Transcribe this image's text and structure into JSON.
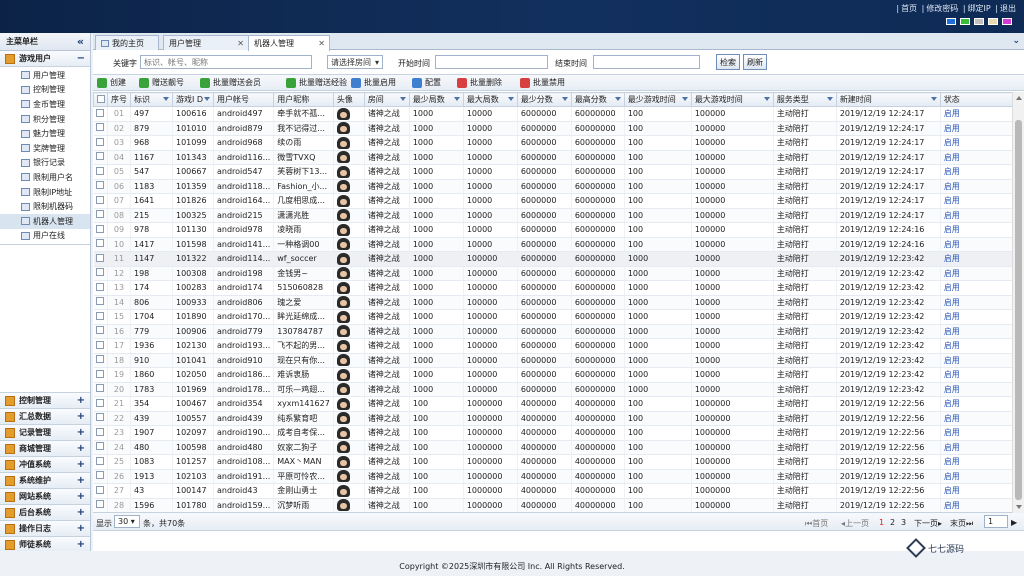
{
  "top_links": [
    "首页",
    "修改密码",
    "绑定IP",
    "退出"
  ],
  "theme_colors": [
    "#1e6fd9",
    "#3dbb3d",
    "#c0c0c0",
    "#e7d8b0",
    "#d53bd6"
  ],
  "sidebar": {
    "title": "主菜单栏",
    "collapse_icon": "double-chevron-left-icon",
    "open_group": {
      "label": "游戏用户",
      "toggle": "−"
    },
    "items": [
      "用户管理",
      "控制管理",
      "金币管理",
      "积分管理",
      "魅力管理",
      "奖牌管理",
      "银行记录",
      "限制用户名",
      "限制IP地址",
      "限制机器码",
      "机器人管理",
      "用户在线"
    ],
    "active_item": "机器人管理",
    "groups": [
      "控制管理",
      "汇总数据",
      "记录管理",
      "商城管理",
      "冲值系统",
      "系统维护",
      "网站系统",
      "后台系统",
      "操作日志",
      "师徒系统"
    ]
  },
  "tabs": [
    {
      "label": "我的主页",
      "closable": false
    },
    {
      "label": "用户管理",
      "closable": true
    },
    {
      "label": "机器人管理",
      "closable": true
    }
  ],
  "active_tab": "机器人管理",
  "search": {
    "keyword_label": "关键字",
    "keyword_placeholder": "标识、帐号、昵称",
    "room_select": "请选择房间",
    "start_label": "开始时间",
    "end_label": "结束时间",
    "search_button": "检索",
    "refresh_button": "刷新"
  },
  "toolbar": [
    {
      "label": "创建",
      "color": "#3aa23a"
    },
    {
      "label": "赠送靓号",
      "color": "#3aa23a"
    },
    {
      "label": "批量赠送会员",
      "color": "#3aa23a"
    },
    {
      "label": "批量赠送经验",
      "color": "#3aa23a"
    },
    {
      "label": "批量启用",
      "color": "#3f7fd0"
    },
    {
      "label": "配置",
      "color": "#3f7fd0"
    },
    {
      "label": "批量删除",
      "color": "#d84040"
    },
    {
      "label": "批量禁用",
      "color": "#d84040"
    }
  ],
  "table": {
    "columns": [
      "序号",
      "标识",
      "游戏I D",
      "用户帐号",
      "用户昵称",
      "头像",
      "房间",
      "最少局数",
      "最大局数",
      "最少分数",
      "最高分数",
      "最少游戏时间",
      "最大游戏时间",
      "服务类型",
      "新建时间",
      "状态"
    ],
    "rows": [
      [
        "01",
        "497",
        "100616",
        "android497",
        "牵手就不孤...",
        "诸神之战",
        "1000",
        "10000",
        "6000000",
        "60000000",
        "100",
        "100000",
        "主动陪打",
        "2019/12/19 12:24:17",
        "启用"
      ],
      [
        "02",
        "879",
        "101010",
        "android879",
        "我不记得过...",
        "诸神之战",
        "1000",
        "10000",
        "6000000",
        "60000000",
        "100",
        "100000",
        "主动陪打",
        "2019/12/19 12:24:17",
        "启用"
      ],
      [
        "03",
        "968",
        "101099",
        "android968",
        "续の雨",
        "诸神之战",
        "1000",
        "10000",
        "6000000",
        "60000000",
        "100",
        "100000",
        "主动陪打",
        "2019/12/19 12:24:17",
        "启用"
      ],
      [
        "04",
        "1167",
        "101343",
        "android116...",
        "微雪TVXQ",
        "诸神之战",
        "1000",
        "10000",
        "6000000",
        "60000000",
        "100",
        "100000",
        "主动陪打",
        "2019/12/19 12:24:17",
        "启用"
      ],
      [
        "05",
        "547",
        "100667",
        "android547",
        "芙蓉树下13...",
        "诸神之战",
        "1000",
        "10000",
        "6000000",
        "60000000",
        "100",
        "100000",
        "主动陪打",
        "2019/12/19 12:24:17",
        "启用"
      ],
      [
        "06",
        "1183",
        "101359",
        "android118...",
        "Fashion_小...",
        "诸神之战",
        "1000",
        "10000",
        "6000000",
        "60000000",
        "100",
        "100000",
        "主动陪打",
        "2019/12/19 12:24:17",
        "启用"
      ],
      [
        "07",
        "1641",
        "101826",
        "android164...",
        "几度相思成...",
        "诸神之战",
        "1000",
        "10000",
        "6000000",
        "60000000",
        "100",
        "100000",
        "主动陪打",
        "2019/12/19 12:24:17",
        "启用"
      ],
      [
        "08",
        "215",
        "100325",
        "android215",
        "潇潇兆胜",
        "诸神之战",
        "1000",
        "10000",
        "6000000",
        "60000000",
        "100",
        "100000",
        "主动陪打",
        "2019/12/19 12:24:17",
        "启用"
      ],
      [
        "09",
        "978",
        "101130",
        "android978",
        "凌晓雨",
        "诸神之战",
        "1000",
        "10000",
        "6000000",
        "60000000",
        "100",
        "100000",
        "主动陪打",
        "2019/12/19 12:24:16",
        "启用"
      ],
      [
        "10",
        "1417",
        "101598",
        "android141...",
        "一种格调00",
        "诸神之战",
        "1000",
        "10000",
        "6000000",
        "60000000",
        "100",
        "100000",
        "主动陪打",
        "2019/12/19 12:24:16",
        "启用"
      ],
      [
        "11",
        "1147",
        "101322",
        "android114...",
        "wf_soccer",
        "诸神之战",
        "1000",
        "100000",
        "6000000",
        "60000000",
        "1000",
        "10000",
        "主动陪打",
        "2019/12/19 12:23:42",
        "启用"
      ],
      [
        "12",
        "198",
        "100308",
        "android198",
        "金钱男~",
        "诸神之战",
        "1000",
        "100000",
        "6000000",
        "60000000",
        "1000",
        "10000",
        "主动陪打",
        "2019/12/19 12:23:42",
        "启用"
      ],
      [
        "13",
        "174",
        "100283",
        "android174",
        "515060828",
        "诸神之战",
        "1000",
        "100000",
        "6000000",
        "60000000",
        "1000",
        "10000",
        "主动陪打",
        "2019/12/19 12:23:42",
        "启用"
      ],
      [
        "14",
        "806",
        "100933",
        "android806",
        "瑰之爱",
        "诸神之战",
        "1000",
        "100000",
        "6000000",
        "60000000",
        "1000",
        "10000",
        "主动陪打",
        "2019/12/19 12:23:42",
        "启用"
      ],
      [
        "15",
        "1704",
        "101890",
        "android170...",
        "眸光延绵成...",
        "诸神之战",
        "1000",
        "100000",
        "6000000",
        "60000000",
        "1000",
        "10000",
        "主动陪打",
        "2019/12/19 12:23:42",
        "启用"
      ],
      [
        "16",
        "779",
        "100906",
        "android779",
        "130784787",
        "诸神之战",
        "1000",
        "100000",
        "6000000",
        "60000000",
        "1000",
        "10000",
        "主动陪打",
        "2019/12/19 12:23:42",
        "启用"
      ],
      [
        "17",
        "1936",
        "102130",
        "android193...",
        "飞不起的男...",
        "诸神之战",
        "1000",
        "100000",
        "6000000",
        "60000000",
        "1000",
        "10000",
        "主动陪打",
        "2019/12/19 12:23:42",
        "启用"
      ],
      [
        "18",
        "910",
        "101041",
        "android910",
        "现在只有你...",
        "诸神之战",
        "1000",
        "100000",
        "6000000",
        "60000000",
        "1000",
        "10000",
        "主动陪打",
        "2019/12/19 12:23:42",
        "启用"
      ],
      [
        "19",
        "1860",
        "102050",
        "android186...",
        "难诉衷肠",
        "诸神之战",
        "1000",
        "100000",
        "6000000",
        "60000000",
        "1000",
        "10000",
        "主动陪打",
        "2019/12/19 12:23:42",
        "启用"
      ],
      [
        "20",
        "1783",
        "101969",
        "android178...",
        "可乐—鸡翅...",
        "诸神之战",
        "1000",
        "100000",
        "6000000",
        "60000000",
        "1000",
        "10000",
        "主动陪打",
        "2019/12/19 12:23:42",
        "启用"
      ],
      [
        "21",
        "354",
        "100467",
        "android354",
        "xyxm141627",
        "诸神之战",
        "100",
        "1000000",
        "4000000",
        "40000000",
        "100",
        "1000000",
        "主动陪打",
        "2019/12/19 12:22:56",
        "启用"
      ],
      [
        "22",
        "439",
        "100557",
        "android439",
        "纯系繁育吧",
        "诸神之战",
        "100",
        "1000000",
        "4000000",
        "40000000",
        "100",
        "1000000",
        "主动陪打",
        "2019/12/19 12:22:56",
        "启用"
      ],
      [
        "23",
        "1907",
        "102097",
        "android190...",
        "成考自考保...",
        "诸神之战",
        "100",
        "1000000",
        "4000000",
        "40000000",
        "100",
        "1000000",
        "主动陪打",
        "2019/12/19 12:22:56",
        "启用"
      ],
      [
        "24",
        "480",
        "100598",
        "android480",
        "奴家二狗子",
        "诸神之战",
        "100",
        "1000000",
        "4000000",
        "40000000",
        "100",
        "1000000",
        "主动陪打",
        "2019/12/19 12:22:56",
        "启用"
      ],
      [
        "25",
        "1083",
        "101257",
        "android108...",
        "MAX丶MAN",
        "诸神之战",
        "100",
        "1000000",
        "4000000",
        "40000000",
        "100",
        "1000000",
        "主动陪打",
        "2019/12/19 12:22:56",
        "启用"
      ],
      [
        "26",
        "1913",
        "102103",
        "android191...",
        "平原可怜农...",
        "诸神之战",
        "100",
        "1000000",
        "4000000",
        "40000000",
        "100",
        "1000000",
        "主动陪打",
        "2019/12/19 12:22:56",
        "启用"
      ],
      [
        "27",
        "43",
        "100147",
        "android43",
        "金刚山勇士",
        "诸神之战",
        "100",
        "1000000",
        "4000000",
        "40000000",
        "100",
        "1000000",
        "主动陪打",
        "2019/12/19 12:22:56",
        "启用"
      ],
      [
        "28",
        "1596",
        "101780",
        "android159...",
        "沉梦听雨",
        "诸神之战",
        "100",
        "1000000",
        "4000000",
        "40000000",
        "100",
        "1000000",
        "主动陪打",
        "2019/12/19 12:22:56",
        "启用"
      ]
    ],
    "highlight_row": 11
  },
  "pager": {
    "show_label": "显示",
    "page_size": "30",
    "total_text": "条，共70条",
    "first": "首页",
    "prev": "上一页",
    "pages": [
      "1",
      "2",
      "3"
    ],
    "current_page": "1",
    "next": "下一页",
    "last": "末页",
    "page_input": "1"
  },
  "footer": {
    "copyright": "Copyright ©2025深圳市有限公司 Inc. All Rights Reserved."
  },
  "watermark": {
    "text": "七七源码"
  }
}
